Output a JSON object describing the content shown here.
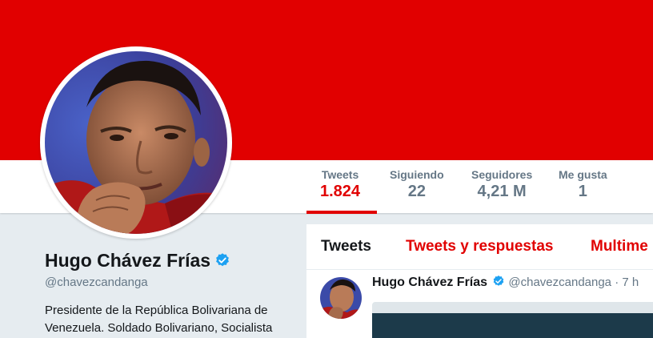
{
  "profile": {
    "name": "Hugo Chávez Frías",
    "handle": "@chavezcandanga",
    "bio": "Presidente de la República Bolivariana de Venezuela. Soldado Bolivariano, Socialista"
  },
  "stats": [
    {
      "label": "Tweets",
      "value": "1.824"
    },
    {
      "label": "Siguiendo",
      "value": "22"
    },
    {
      "label": "Seguidores",
      "value": "4,21 M"
    },
    {
      "label": "Me gusta",
      "value": "1"
    }
  ],
  "tabs": [
    "Tweets",
    "Tweets y respuestas",
    "Multime"
  ],
  "tweet": {
    "name": "Hugo Chávez Frías",
    "handle": "@chavezcandanga",
    "separator": "·",
    "time": "7 h"
  },
  "colors": {
    "banner": "#e10000",
    "accent": "#e10000",
    "verified": "#1da1f2"
  },
  "icons": {
    "verified": "verified-badge-icon"
  }
}
